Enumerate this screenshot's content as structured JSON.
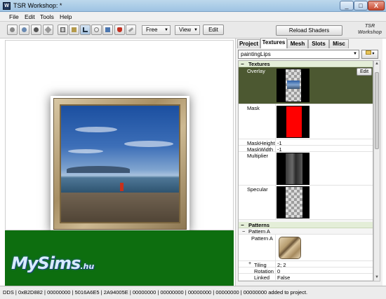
{
  "window": {
    "title": "TSR Workshop: *",
    "app_icon": "W"
  },
  "window_controls": [
    "_",
    "□",
    "X"
  ],
  "menu": [
    "File",
    "Edit",
    "Tools",
    "Help"
  ],
  "toolbar": {
    "camera_mode": "Free",
    "view_mode": "View",
    "edit_label": "Edit",
    "reload_shaders_label": "Reload Shaders",
    "logo_text": "TSR Workshop"
  },
  "watermark": {
    "main": "MySims",
    "suffix": ".hu"
  },
  "panel": {
    "tabs": [
      "Project",
      "Textures",
      "Mesh",
      "Slots",
      "Misc"
    ],
    "active_tab": "Textures",
    "preset": "paintingLips",
    "sections": {
      "textures": "Textures",
      "patterns": "Patterns",
      "pattern_a_group": "Pattern A"
    },
    "edit_label": "Edit",
    "rows": {
      "overlay": "Overlay",
      "mask": "Mask",
      "mask_height_label": "MaskHeight",
      "mask_height_value": "-1",
      "mask_width_label": "MaskWidth",
      "mask_width_value": "-1",
      "multiplier": "Multiplier",
      "specular": "Specular",
      "pattern_a": "Pattern A",
      "tiling_label": "Tiling",
      "tiling_value": "2; 2",
      "rotation_label": "Rotation",
      "rotation_value": "0",
      "linked_label": "Linked",
      "linked_value": "False"
    }
  },
  "status_text": "DDS | 0xB2D882 | 00000000 | 5016A6E5 | 2A94005E | 00000000 | 00000000 | 00000000 | 00000000 | 00000000 added to project.",
  "colors": {
    "floor_green": "#0d6e0f",
    "selected_row": "#4c5831",
    "mask_red": "#ff0000"
  }
}
